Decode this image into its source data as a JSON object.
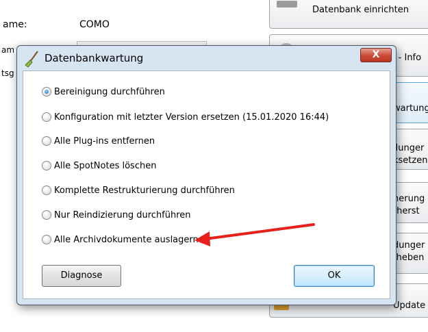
{
  "background": {
    "name_label": "ame:",
    "name_value": "COMO",
    "left_fragments": [
      "am",
      "tsg"
    ],
    "buttons": [
      "Datenbank einrichten",
      "k - Info",
      "wartung",
      "llunger",
      "ksetzen",
      "herung",
      "rherst",
      "dunger",
      "fheben",
      "Update"
    ]
  },
  "dialog": {
    "title": "Datenbankwartung",
    "close_label": "X",
    "options": [
      {
        "label": "Bereinigung durchführen",
        "checked": true
      },
      {
        "label": "Konfiguration mit letzter Version ersetzen (15.01.2020 16:44)",
        "checked": false
      },
      {
        "label": "Alle Plug-ins entfernen",
        "checked": false
      },
      {
        "label": "Alle SpotNotes löschen",
        "checked": false
      },
      {
        "label": "Komplette Restrukturierung durchführen",
        "checked": false
      },
      {
        "label": "Nur Reindizierung durchführen",
        "checked": false
      },
      {
        "label": "Alle Archivdokumente auslagern",
        "checked": false
      }
    ],
    "diagnose_label": "Diagnose",
    "ok_label": "OK"
  },
  "colors": {
    "arrow": "#e8201c",
    "accent": "#1b68b5"
  }
}
